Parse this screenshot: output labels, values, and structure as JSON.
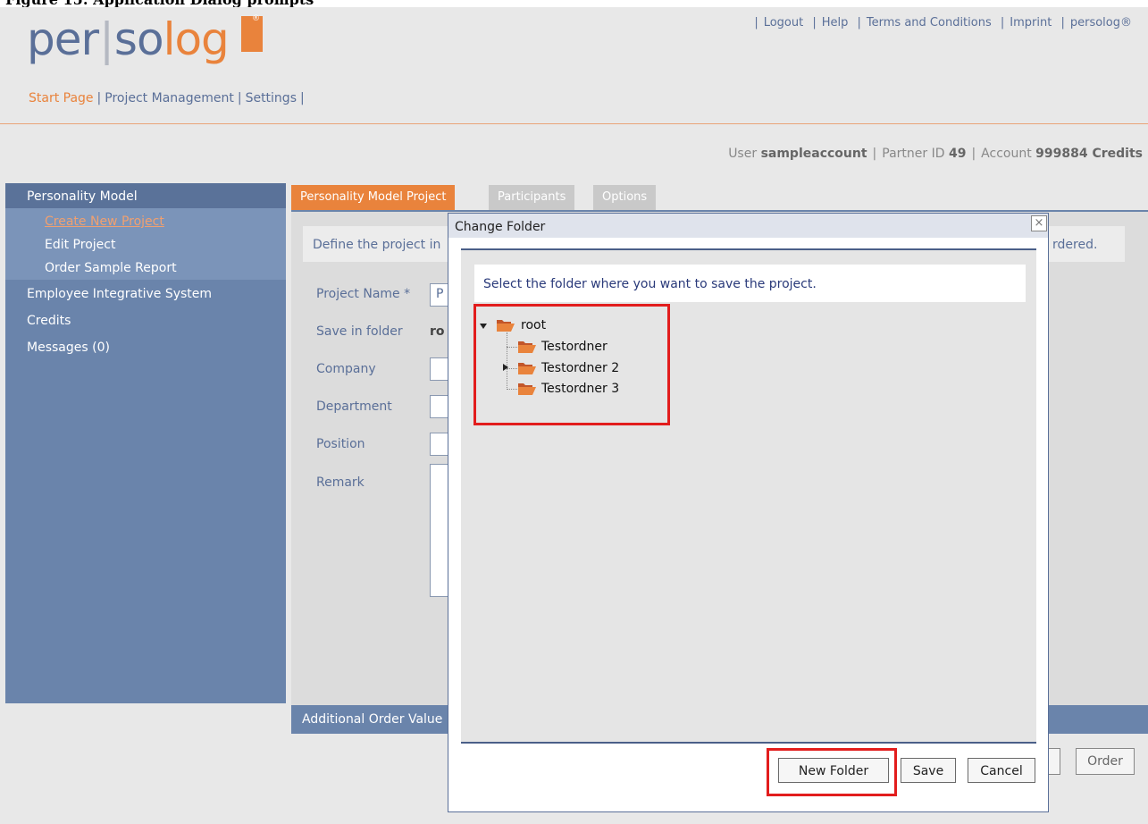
{
  "caption": "Figure 15: Application Dialog prompts",
  "logo": {
    "per": "per",
    "sep": "|",
    "so": "so",
    "log": "log",
    "reg": "®"
  },
  "topnav": [
    "Logout",
    "Help",
    "Terms and Conditions",
    "Imprint",
    "persolog®"
  ],
  "mainnav": [
    {
      "label": "Start Page",
      "active": true
    },
    {
      "label": "Project Management"
    },
    {
      "label": "Settings"
    }
  ],
  "user": {
    "user_label": "User",
    "username": "sampleaccount",
    "partner_label": "Partner ID",
    "partner_id": "49",
    "account_label": "Account",
    "credits": "999884 Credits"
  },
  "sidebar": {
    "section": "Personality Model",
    "subitems": [
      "Create New Project",
      "Edit Project",
      "Order Sample Report"
    ],
    "items": [
      "Employee Integrative System",
      "Credits",
      "Messages (0)"
    ]
  },
  "tabs": [
    "Personality Model Project",
    "Participants",
    "Options"
  ],
  "form": {
    "info_left": "Define the project in",
    "info_right": "rdered.",
    "labels": [
      "Project Name *",
      "Save in folder",
      "Company",
      "Department",
      "Position",
      "Remark"
    ],
    "project_name_prefix": "P",
    "folder_prefix": "ro"
  },
  "bottom_bar": "Additional Order Value",
  "order_button": "Order",
  "dialog": {
    "title": "Change Folder",
    "close": "×",
    "instruction": "Select the folder where you want to save the project.",
    "tree": {
      "root": "root",
      "children": [
        "Testordner",
        "Testordner 2",
        "Testordner 3"
      ]
    },
    "buttons": {
      "new_folder": "New Folder",
      "save": "Save",
      "cancel": "Cancel"
    }
  },
  "colors": {
    "accent": "#e9833c",
    "primary": "#6a84ab",
    "highlight": "#e21d1d"
  }
}
